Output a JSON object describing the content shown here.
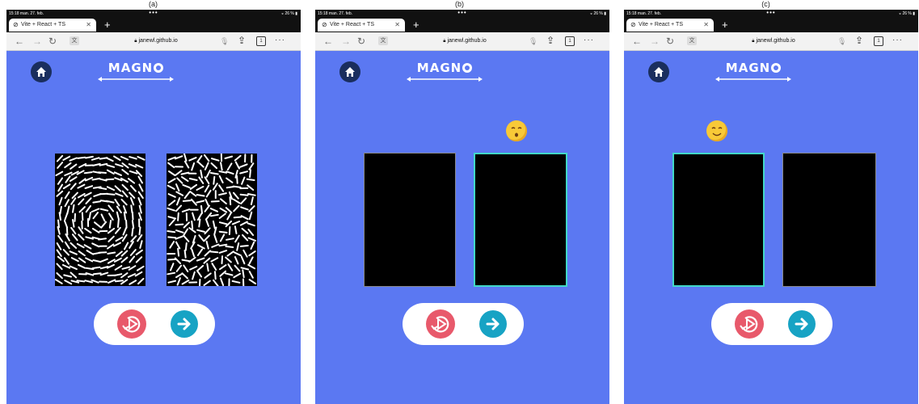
{
  "captions": [
    "(a)",
    "(b)",
    "(c)"
  ],
  "panels": [
    {
      "status": {
        "time": "15:18  man. 27. feb.",
        "battery": "26 %"
      },
      "tab": {
        "title": "Vite + React + TS"
      },
      "address": {
        "url": "janewl.github.io",
        "tab_count": "1"
      },
      "logo": {
        "text": "MAGN"
      },
      "stimulus": "patterns",
      "selected_box": "none"
    },
    {
      "status": {
        "time": "15:18  man. 27. feb.",
        "battery": "26 %"
      },
      "tab": {
        "title": "Vite + React + TS"
      },
      "address": {
        "url": "janewl.github.io",
        "tab_count": "1"
      },
      "logo": {
        "text": "MAGN"
      },
      "stimulus": "blank",
      "selected_box": "right",
      "emoji": "surprised-face"
    },
    {
      "status": {
        "time": "15:18  man. 27. feb.",
        "battery": "26 %"
      },
      "tab": {
        "title": "Vite + React + TS"
      },
      "address": {
        "url": "janewl.github.io",
        "tab_count": "1"
      },
      "logo": {
        "text": "MAGN"
      },
      "stimulus": "blank",
      "selected_box": "left",
      "emoji": "smiling-face"
    }
  ],
  "colors": {
    "page_bg": "#5b78f2",
    "selection": "#41d8c8",
    "replay": "#e8596b",
    "next": "#17a3c4",
    "home": "#1a2e5e",
    "emoji": "#f8c937"
  },
  "icons": {
    "home": "home-icon",
    "replay": "replay-icon",
    "next": "arrow-right-icon"
  }
}
